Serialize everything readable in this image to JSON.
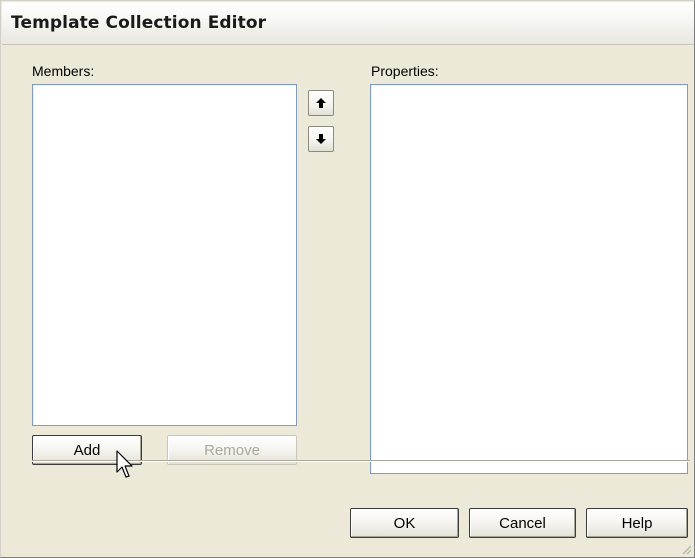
{
  "window": {
    "title": "Template Collection Editor"
  },
  "members": {
    "label": "Members:"
  },
  "properties": {
    "label": "Properties:"
  },
  "buttons": {
    "add": "Add",
    "remove": "Remove",
    "ok": "OK",
    "cancel": "Cancel",
    "help": "Help"
  },
  "icons": {
    "move_up": "arrow-up-icon",
    "move_down": "arrow-down-icon",
    "cursor": "mouse-pointer-icon",
    "resize": "resize-grip-icon"
  },
  "state": {
    "remove_enabled": false
  }
}
